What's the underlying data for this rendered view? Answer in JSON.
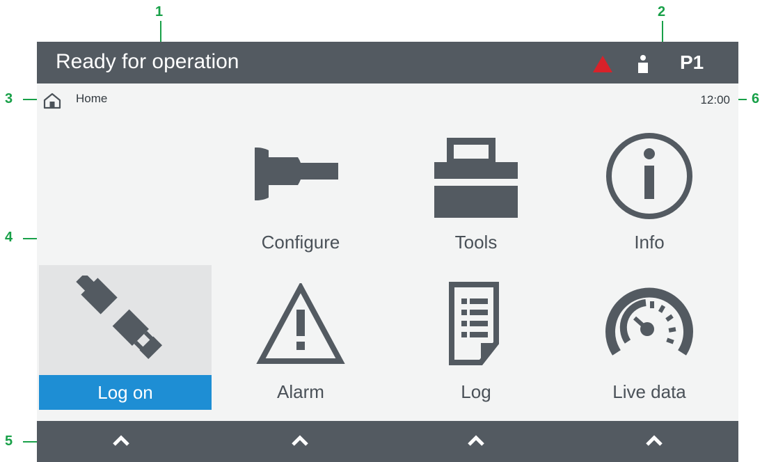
{
  "callouts": [
    "1",
    "2",
    "3",
    "4",
    "5",
    "6"
  ],
  "topbar": {
    "status": "Ready for operation",
    "profile": "P1",
    "alarm_icon": "warning-triangle-icon",
    "user_icon": "user-icon"
  },
  "breadcrumb": {
    "label": "Home",
    "icon": "home-icon"
  },
  "clock": "12:00",
  "tiles": [
    {
      "label": "Configure",
      "icon": "wrench-icon"
    },
    {
      "label": "Tools",
      "icon": "toolbox-icon"
    },
    {
      "label": "Info",
      "icon": "info-icon"
    },
    {
      "label": "Log on",
      "icon": "plug-icon",
      "selected": true
    },
    {
      "label": "Alarm",
      "icon": "alarm-triangle-icon"
    },
    {
      "label": "Log",
      "icon": "document-list-icon"
    },
    {
      "label": "Live data",
      "icon": "gauge-icon"
    }
  ],
  "bottombar": {
    "buttons": [
      "chevron-up-icon",
      "chevron-up-icon",
      "chevron-up-icon",
      "chevron-up-icon"
    ]
  },
  "colors": {
    "bar": "#535a61",
    "content_bg": "#f3f4f4",
    "accent_blue": "#1e8ed4",
    "alarm_red": "#d8222a",
    "callout_green": "#18a048"
  }
}
